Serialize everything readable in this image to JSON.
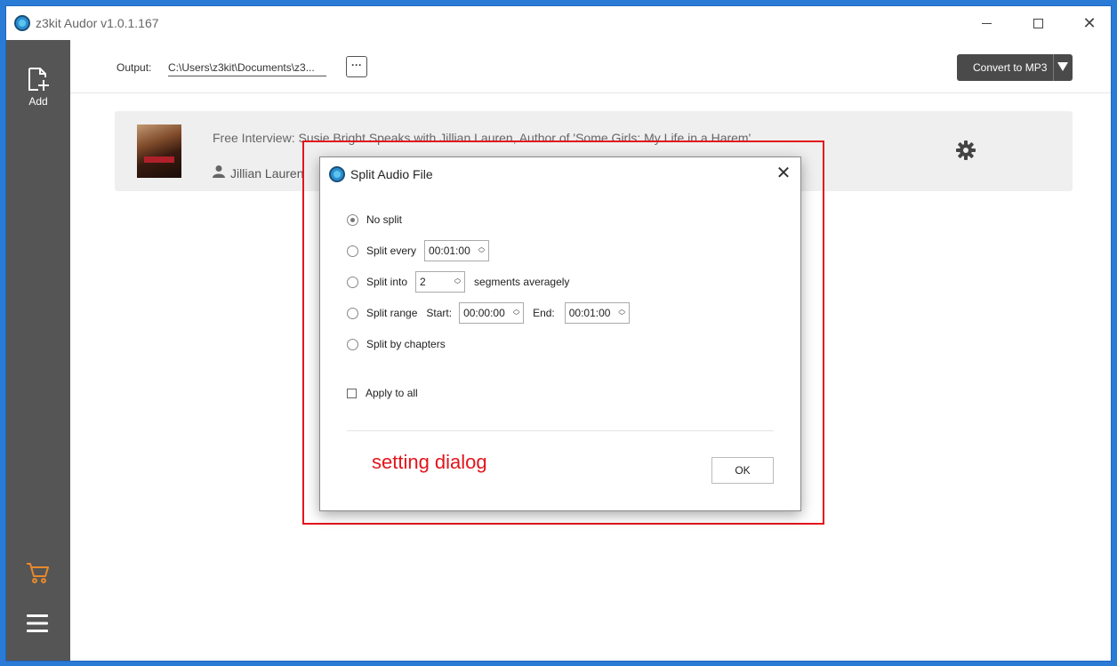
{
  "window": {
    "title": "z3kit Audor v1.0.1.167"
  },
  "sidebar": {
    "add_label": "Add"
  },
  "toolbar": {
    "output_label": "Output:",
    "output_path": "C:\\Users\\z3kit\\Documents\\z3...",
    "browse_label": "···",
    "convert_label": "Convert to MP3"
  },
  "file": {
    "title": "Free Interview: Susie Bright Speaks with Jillian Lauren, Author of 'Some Girls: My Life in a Harem'",
    "author": "Jillian Lauren"
  },
  "dialog": {
    "title": "Split Audio File",
    "options": {
      "no_split": "No split",
      "split_every": "Split every",
      "split_every_value": "00:01:00",
      "split_into": "Split into",
      "split_into_value": "2",
      "segments_suffix": "segments averagely",
      "split_range": "Split range",
      "start_label": "Start:",
      "start_value": "00:00:00",
      "end_label": "End:",
      "end_value": "00:01:00",
      "split_chapters": "Split by chapters",
      "selected": "No split"
    },
    "apply_to_all": "Apply to all",
    "apply_to_all_checked": false,
    "ok_label": "OK"
  },
  "annotation": {
    "text": "setting dialog",
    "color": "#e3141c"
  },
  "colors": {
    "sidebar": "#555555",
    "convert_button": "#4a4a4a",
    "cart_accent": "#e8892b",
    "desktop": "#2a7bd6"
  }
}
